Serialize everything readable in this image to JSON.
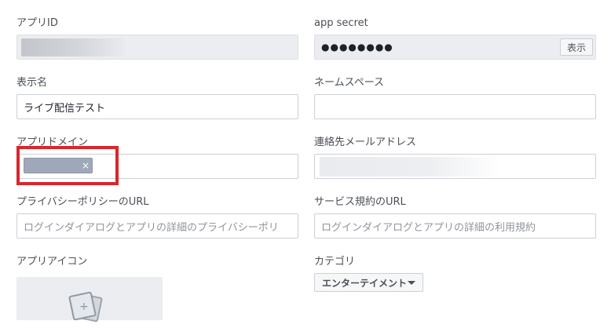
{
  "form": {
    "app_id": {
      "label": "アプリID"
    },
    "app_secret": {
      "label": "app secret",
      "value": "●●●●●●●●",
      "show_button": "表示"
    },
    "display_name": {
      "label": "表示名",
      "value": "ライブ配信テスト"
    },
    "namespace": {
      "label": "ネームスペース",
      "value": ""
    },
    "app_domain": {
      "label": "アプリドメイン",
      "token_remove": "×"
    },
    "contact_email": {
      "label": "連絡先メールアドレス"
    },
    "privacy_url": {
      "label": "プライバシーポリシーのURL",
      "placeholder": "ログインダイアログとアプリの詳細のプライバシーポリ"
    },
    "terms_url": {
      "label": "サービス規約のURL",
      "placeholder": "ログインダイアログとアプリの詳細の利用規約"
    },
    "app_icon": {
      "label": "アプリアイコン"
    },
    "category": {
      "label": "カテゴリ",
      "value": "エンターテイメント"
    }
  },
  "colors": {
    "highlight": "#d9262c",
    "field_border": "#ccd0d5",
    "readonly_bg": "#ebedf0"
  }
}
